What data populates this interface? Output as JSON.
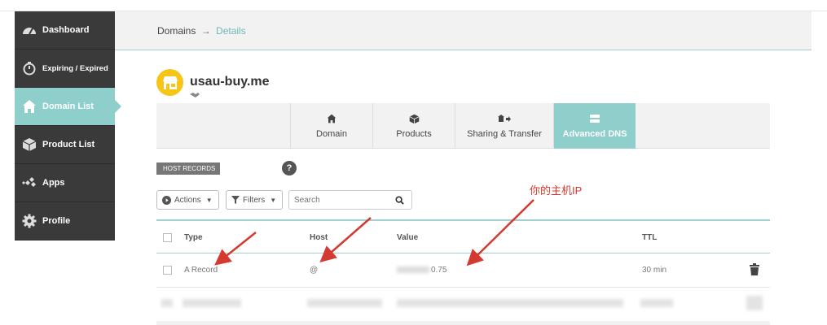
{
  "sidebar": {
    "items": [
      {
        "label": "Dashboard",
        "icon": "gauge-icon"
      },
      {
        "label": "Expiring / Expired",
        "icon": "stopwatch-icon"
      },
      {
        "label": "Domain List",
        "icon": "home-icon",
        "active": true
      },
      {
        "label": "Product List",
        "icon": "box-icon"
      },
      {
        "label": "Apps",
        "icon": "apps-icon"
      },
      {
        "label": "Profile",
        "icon": "gear-icon"
      }
    ]
  },
  "breadcrumb": {
    "root": "Domains",
    "separator": "→",
    "current": "Details"
  },
  "domain": {
    "name": "usau-buy.me",
    "logo_icon": "store-icon"
  },
  "tabs": [
    {
      "label": "Domain",
      "icon": "home-icon"
    },
    {
      "label": "Products",
      "icon": "box-icon"
    },
    {
      "label": "Sharing & Transfer",
      "icon": "share-icon"
    },
    {
      "label": "Advanced DNS",
      "icon": "server-icon",
      "active": true
    }
  ],
  "host_records": {
    "label": "HOST RECORDS",
    "help": "?"
  },
  "toolbar": {
    "actions_label": "Actions",
    "filters_label": "Filters",
    "search_placeholder": "Search"
  },
  "annotation": {
    "text": "你的主机IP",
    "color": "#d43a2f"
  },
  "table": {
    "headers": {
      "type": "Type",
      "host": "Host",
      "value": "Value",
      "ttl": "TTL"
    },
    "rows": [
      {
        "type": "A Record",
        "host": "@",
        "value_suffix": "0.75",
        "ttl": "30 min"
      }
    ]
  },
  "colors": {
    "accent": "#8ecfcb",
    "sidebar": "#3a3a3a",
    "logo": "#f5c518",
    "link": "#6fb8b5"
  }
}
